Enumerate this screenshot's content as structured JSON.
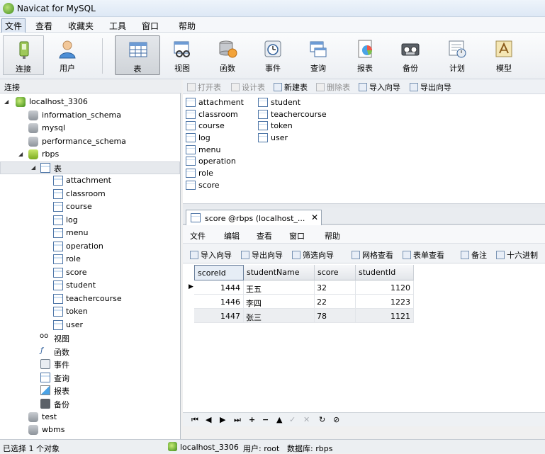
{
  "window": {
    "title": "Navicat for MySQL"
  },
  "menubar": {
    "items": [
      "文件",
      "查看",
      "收藏夹",
      "工具",
      "窗口",
      "帮助"
    ]
  },
  "toolbar": {
    "items": [
      {
        "label": "连接",
        "icon": "connect-icon"
      },
      {
        "label": "用户",
        "icon": "user-icon"
      },
      {
        "label": "表",
        "icon": "table-icon"
      },
      {
        "label": "视图",
        "icon": "view-icon"
      },
      {
        "label": "函数",
        "icon": "function-icon"
      },
      {
        "label": "事件",
        "icon": "event-icon"
      },
      {
        "label": "查询",
        "icon": "query-icon"
      },
      {
        "label": "报表",
        "icon": "report-icon"
      },
      {
        "label": "备份",
        "icon": "backup-icon"
      },
      {
        "label": "计划",
        "icon": "schedule-icon"
      },
      {
        "label": "模型",
        "icon": "model-icon"
      }
    ],
    "selected": "表"
  },
  "sidebar": {
    "header": "连接",
    "connection": "localhost_3306",
    "databases": [
      "information_schema",
      "mysql",
      "performance_schema",
      "rbps"
    ],
    "tables_node": "表",
    "tables": [
      "attachment",
      "classroom",
      "course",
      "log",
      "menu",
      "operation",
      "role",
      "score",
      "student",
      "teachercourse",
      "token",
      "user"
    ],
    "other_nodes": [
      "视图",
      "函数",
      "事件",
      "查询",
      "报表",
      "备份"
    ],
    "more_databases": [
      "test",
      "wbms"
    ]
  },
  "object_toolbar": {
    "items": [
      {
        "label": "打开表",
        "enabled": false
      },
      {
        "label": "设计表",
        "enabled": false
      },
      {
        "label": "新建表",
        "enabled": true
      },
      {
        "label": "删除表",
        "enabled": false
      },
      {
        "label": "导入向导",
        "enabled": true
      },
      {
        "label": "导出向导",
        "enabled": true
      }
    ]
  },
  "object_list": {
    "col1": [
      "attachment",
      "classroom",
      "course",
      "log",
      "menu",
      "operation",
      "role",
      "score"
    ],
    "col2": [
      "student",
      "teachercourse",
      "token",
      "user"
    ]
  },
  "tab": {
    "label": "score @rbps (localhost_...",
    "close": "✕"
  },
  "inner_menu": {
    "items": [
      "文件",
      "编辑",
      "查看",
      "窗口",
      "帮助"
    ]
  },
  "inner_toolbar": {
    "items": [
      "导入向导",
      "导出向导",
      "筛选向导",
      "网格查看",
      "表单查看",
      "备注",
      "十六进制"
    ]
  },
  "grid": {
    "columns": [
      "scoreId",
      "studentName",
      "score",
      "studentId"
    ],
    "rows": [
      [
        "1444",
        "王五",
        "32",
        "1120"
      ],
      [
        "1446",
        "李四",
        "22",
        "1223"
      ],
      [
        "1447",
        "张三",
        "78",
        "1121"
      ]
    ],
    "current_row_marker": "▶"
  },
  "navbar": {
    "buttons": [
      "⏮",
      "◀",
      "▶",
      "⏭",
      "+",
      "−",
      "▲",
      "✓",
      "✕",
      "↻",
      "⊘"
    ]
  },
  "statusbar": {
    "selection": "已选择 1 个对象",
    "connection": "localhost_3306",
    "user": "用户: root",
    "database": "数据库: rbps"
  }
}
